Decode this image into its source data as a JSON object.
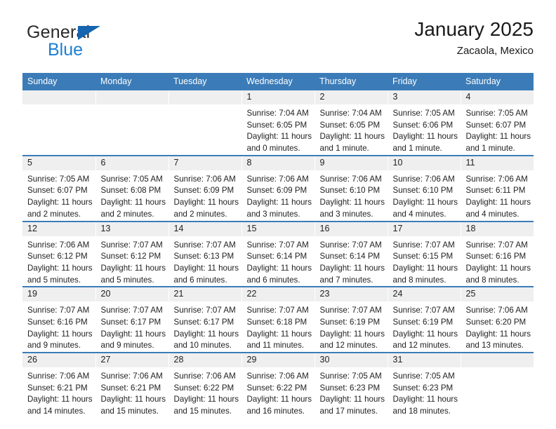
{
  "brand": {
    "name_part1": "General",
    "name_part2": "Blue",
    "triangle_color": "#1565b0",
    "blue_color": "#1b7fd4"
  },
  "header": {
    "title": "January 2025",
    "subtitle": "Zacaola, Mexico"
  },
  "theme": {
    "header_blue": "#3b7cb8",
    "daynum_gray": "#efefef"
  },
  "calendar": {
    "weekdays": [
      "Sunday",
      "Monday",
      "Tuesday",
      "Wednesday",
      "Thursday",
      "Friday",
      "Saturday"
    ],
    "weeks": [
      [
        {
          "day": "",
          "blank": true,
          "sunrise": "",
          "sunset": "",
          "daylight1": "",
          "daylight2": ""
        },
        {
          "day": "",
          "blank": true,
          "sunrise": "",
          "sunset": "",
          "daylight1": "",
          "daylight2": ""
        },
        {
          "day": "",
          "blank": true,
          "sunrise": "",
          "sunset": "",
          "daylight1": "",
          "daylight2": ""
        },
        {
          "day": "1",
          "sunrise": "Sunrise: 7:04 AM",
          "sunset": "Sunset: 6:05 PM",
          "daylight1": "Daylight: 11 hours",
          "daylight2": "and 0 minutes."
        },
        {
          "day": "2",
          "sunrise": "Sunrise: 7:04 AM",
          "sunset": "Sunset: 6:05 PM",
          "daylight1": "Daylight: 11 hours",
          "daylight2": "and 1 minute."
        },
        {
          "day": "3",
          "sunrise": "Sunrise: 7:05 AM",
          "sunset": "Sunset: 6:06 PM",
          "daylight1": "Daylight: 11 hours",
          "daylight2": "and 1 minute."
        },
        {
          "day": "4",
          "sunrise": "Sunrise: 7:05 AM",
          "sunset": "Sunset: 6:07 PM",
          "daylight1": "Daylight: 11 hours",
          "daylight2": "and 1 minute."
        }
      ],
      [
        {
          "day": "5",
          "sunrise": "Sunrise: 7:05 AM",
          "sunset": "Sunset: 6:07 PM",
          "daylight1": "Daylight: 11 hours",
          "daylight2": "and 2 minutes."
        },
        {
          "day": "6",
          "sunrise": "Sunrise: 7:05 AM",
          "sunset": "Sunset: 6:08 PM",
          "daylight1": "Daylight: 11 hours",
          "daylight2": "and 2 minutes."
        },
        {
          "day": "7",
          "sunrise": "Sunrise: 7:06 AM",
          "sunset": "Sunset: 6:09 PM",
          "daylight1": "Daylight: 11 hours",
          "daylight2": "and 2 minutes."
        },
        {
          "day": "8",
          "sunrise": "Sunrise: 7:06 AM",
          "sunset": "Sunset: 6:09 PM",
          "daylight1": "Daylight: 11 hours",
          "daylight2": "and 3 minutes."
        },
        {
          "day": "9",
          "sunrise": "Sunrise: 7:06 AM",
          "sunset": "Sunset: 6:10 PM",
          "daylight1": "Daylight: 11 hours",
          "daylight2": "and 3 minutes."
        },
        {
          "day": "10",
          "sunrise": "Sunrise: 7:06 AM",
          "sunset": "Sunset: 6:10 PM",
          "daylight1": "Daylight: 11 hours",
          "daylight2": "and 4 minutes."
        },
        {
          "day": "11",
          "sunrise": "Sunrise: 7:06 AM",
          "sunset": "Sunset: 6:11 PM",
          "daylight1": "Daylight: 11 hours",
          "daylight2": "and 4 minutes."
        }
      ],
      [
        {
          "day": "12",
          "sunrise": "Sunrise: 7:06 AM",
          "sunset": "Sunset: 6:12 PM",
          "daylight1": "Daylight: 11 hours",
          "daylight2": "and 5 minutes."
        },
        {
          "day": "13",
          "sunrise": "Sunrise: 7:07 AM",
          "sunset": "Sunset: 6:12 PM",
          "daylight1": "Daylight: 11 hours",
          "daylight2": "and 5 minutes."
        },
        {
          "day": "14",
          "sunrise": "Sunrise: 7:07 AM",
          "sunset": "Sunset: 6:13 PM",
          "daylight1": "Daylight: 11 hours",
          "daylight2": "and 6 minutes."
        },
        {
          "day": "15",
          "sunrise": "Sunrise: 7:07 AM",
          "sunset": "Sunset: 6:14 PM",
          "daylight1": "Daylight: 11 hours",
          "daylight2": "and 6 minutes."
        },
        {
          "day": "16",
          "sunrise": "Sunrise: 7:07 AM",
          "sunset": "Sunset: 6:14 PM",
          "daylight1": "Daylight: 11 hours",
          "daylight2": "and 7 minutes."
        },
        {
          "day": "17",
          "sunrise": "Sunrise: 7:07 AM",
          "sunset": "Sunset: 6:15 PM",
          "daylight1": "Daylight: 11 hours",
          "daylight2": "and 8 minutes."
        },
        {
          "day": "18",
          "sunrise": "Sunrise: 7:07 AM",
          "sunset": "Sunset: 6:16 PM",
          "daylight1": "Daylight: 11 hours",
          "daylight2": "and 8 minutes."
        }
      ],
      [
        {
          "day": "19",
          "sunrise": "Sunrise: 7:07 AM",
          "sunset": "Sunset: 6:16 PM",
          "daylight1": "Daylight: 11 hours",
          "daylight2": "and 9 minutes."
        },
        {
          "day": "20",
          "sunrise": "Sunrise: 7:07 AM",
          "sunset": "Sunset: 6:17 PM",
          "daylight1": "Daylight: 11 hours",
          "daylight2": "and 9 minutes."
        },
        {
          "day": "21",
          "sunrise": "Sunrise: 7:07 AM",
          "sunset": "Sunset: 6:17 PM",
          "daylight1": "Daylight: 11 hours",
          "daylight2": "and 10 minutes."
        },
        {
          "day": "22",
          "sunrise": "Sunrise: 7:07 AM",
          "sunset": "Sunset: 6:18 PM",
          "daylight1": "Daylight: 11 hours",
          "daylight2": "and 11 minutes."
        },
        {
          "day": "23",
          "sunrise": "Sunrise: 7:07 AM",
          "sunset": "Sunset: 6:19 PM",
          "daylight1": "Daylight: 11 hours",
          "daylight2": "and 12 minutes."
        },
        {
          "day": "24",
          "sunrise": "Sunrise: 7:07 AM",
          "sunset": "Sunset: 6:19 PM",
          "daylight1": "Daylight: 11 hours",
          "daylight2": "and 12 minutes."
        },
        {
          "day": "25",
          "sunrise": "Sunrise: 7:06 AM",
          "sunset": "Sunset: 6:20 PM",
          "daylight1": "Daylight: 11 hours",
          "daylight2": "and 13 minutes."
        }
      ],
      [
        {
          "day": "26",
          "sunrise": "Sunrise: 7:06 AM",
          "sunset": "Sunset: 6:21 PM",
          "daylight1": "Daylight: 11 hours",
          "daylight2": "and 14 minutes."
        },
        {
          "day": "27",
          "sunrise": "Sunrise: 7:06 AM",
          "sunset": "Sunset: 6:21 PM",
          "daylight1": "Daylight: 11 hours",
          "daylight2": "and 15 minutes."
        },
        {
          "day": "28",
          "sunrise": "Sunrise: 7:06 AM",
          "sunset": "Sunset: 6:22 PM",
          "daylight1": "Daylight: 11 hours",
          "daylight2": "and 15 minutes."
        },
        {
          "day": "29",
          "sunrise": "Sunrise: 7:06 AM",
          "sunset": "Sunset: 6:22 PM",
          "daylight1": "Daylight: 11 hours",
          "daylight2": "and 16 minutes."
        },
        {
          "day": "30",
          "sunrise": "Sunrise: 7:05 AM",
          "sunset": "Sunset: 6:23 PM",
          "daylight1": "Daylight: 11 hours",
          "daylight2": "and 17 minutes."
        },
        {
          "day": "31",
          "sunrise": "Sunrise: 7:05 AM",
          "sunset": "Sunset: 6:23 PM",
          "daylight1": "Daylight: 11 hours",
          "daylight2": "and 18 minutes."
        },
        {
          "day": "",
          "blank": true,
          "sunrise": "",
          "sunset": "",
          "daylight1": "",
          "daylight2": ""
        }
      ]
    ]
  }
}
